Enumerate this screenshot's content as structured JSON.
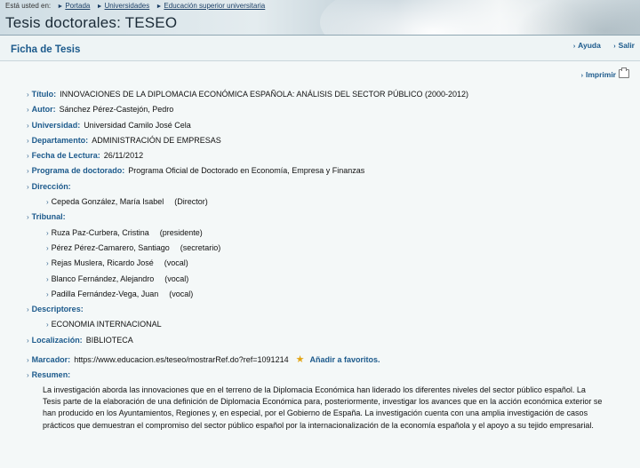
{
  "breadcrumb": {
    "prefix": "Está usted en:",
    "items": [
      "Portada",
      "Universidades",
      "Educación superior universitaria"
    ]
  },
  "site_title": "Tesis doctorales: TESEO",
  "header": {
    "heading": "Ficha de Tesis",
    "links": [
      "Ayuda",
      "Salir"
    ],
    "print_label": "Imprimir"
  },
  "thesis": {
    "titulo_label": "Título:",
    "titulo": "INNOVACIONES DE LA DIPLOMACIA ECONÓMICA ESPAÑOLA: ANÁLISIS DEL SECTOR PÚBLICO (2000-2012)",
    "autor_label": "Autor:",
    "autor": "Sánchez Pérez-Castejón, Pedro",
    "universidad_label": "Universidad:",
    "universidad": "Universidad Camilo José Cela",
    "departamento_label": "Departamento:",
    "departamento": "ADMINISTRACIÓN DE EMPRESAS",
    "fecha_label": "Fecha de Lectura:",
    "fecha": "26/11/2012",
    "programa_label": "Programa de doctorado:",
    "programa": "Programa Oficial de Doctorado en Economía, Empresa y Finanzas",
    "direccion_label": "Dirección:",
    "direccion": [
      {
        "name": "Cepeda González, María Isabel",
        "role": "(Director)"
      }
    ],
    "tribunal_label": "Tribunal:",
    "tribunal": [
      {
        "name": "Ruza Paz-Curbera, Cristina",
        "role": "(presidente)"
      },
      {
        "name": "Pérez Pérez-Camarero, Santiago",
        "role": "(secretario)"
      },
      {
        "name": "Rejas Muslera, Ricardo José",
        "role": "(vocal)"
      },
      {
        "name": "Blanco Fernández, Alejandro",
        "role": "(vocal)"
      },
      {
        "name": "Padilla Fernández-Vega, Juan",
        "role": "(vocal)"
      }
    ],
    "descriptores_label": "Descriptores:",
    "descriptores": [
      "ECONOMIA INTERNACIONAL"
    ],
    "localizacion_label": "Localización:",
    "localizacion": "BIBLIOTECA",
    "marcador_label": "Marcador:",
    "marcador": "https://www.educacion.es/teseo/mostrarRef.do?ref=1091214",
    "favoritos": "Añadir a favoritos.",
    "resumen_label": "Resumen:",
    "resumen": "La investigación aborda las innovaciones que en el terreno de la Diplomacia Económica han liderado los diferentes niveles del sector público español. La Tesis parte de la elaboración de una definición de Diplomacia Económica para, posteriormente, investigar los avances que en la acción económica exterior se han producido en los Ayuntamientos, Regiones y, en especial, por el Gobierno de España. La investigación cuenta con una amplia investigación de casos prácticos que demuestran el compromiso del sector público español por la internacionalización de la economía española y el apoyo a su tejido empresarial."
  },
  "icons": {
    "arrow": "chevron-right-icon",
    "star": "star-icon",
    "printer": "printer-icon"
  },
  "colors": {
    "label_blue": "#1c5a8c",
    "link_blue": "#1b3f66",
    "background": "#f4f8f8"
  }
}
